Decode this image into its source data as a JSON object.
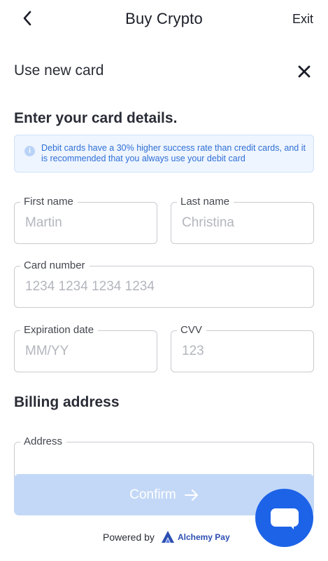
{
  "header": {
    "title": "Buy Crypto",
    "exit_label": "Exit",
    "back_icon": "chevron-left-icon"
  },
  "section": {
    "title": "Use new card",
    "close_icon": "close-icon"
  },
  "card_form": {
    "heading": "Enter your card details.",
    "info": {
      "icon": "info-icon",
      "text": "Debit cards have a 30% higher success rate than credit cards, and it is recommended that you always use your debit card"
    },
    "first_name": {
      "label": "First name",
      "placeholder": "Martin",
      "value": ""
    },
    "last_name": {
      "label": "Last name",
      "placeholder": "Christina",
      "value": ""
    },
    "card_number": {
      "label": "Card number",
      "placeholder": "1234 1234 1234 1234",
      "value": ""
    },
    "expiration": {
      "label": "Expiration date",
      "placeholder": "MM/YY",
      "value": ""
    },
    "cvv": {
      "label": "CVV",
      "placeholder": "123",
      "value": ""
    }
  },
  "billing": {
    "heading": "Billing address",
    "address": {
      "label": "Address",
      "placeholder": "",
      "value": ""
    }
  },
  "confirm": {
    "label": "Confirm",
    "icon": "arrow-right-icon"
  },
  "footer": {
    "powered_by": "Powered by",
    "brand": "Alchemy Pay"
  },
  "chat": {
    "icon": "chat-bubble-icon"
  },
  "colors": {
    "accent": "#1d63e8",
    "confirm_disabled": "#c3d8f7",
    "info_bg": "#eef5ff",
    "info_text": "#2f6fd6"
  }
}
